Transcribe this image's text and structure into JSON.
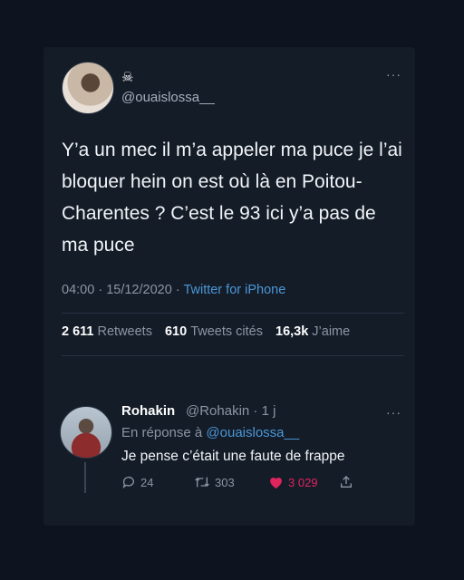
{
  "tweet": {
    "icon": "skull-icon",
    "handle": "@ouaislossa__",
    "text": "Y’a un mec il m’a appeler ma puce je l’ai bloquer hein on est où là en Poitou-Charentes ? C’est le 93 ici y’a pas de ma puce",
    "time": "04:00",
    "date": "15/12/2020",
    "separator": "·",
    "source": "Twitter for iPhone",
    "stats": {
      "retweets_count": "2 611",
      "retweets_label": "Retweets",
      "quotes_count": "610",
      "quotes_label": "Tweets cités",
      "likes_count": "16,3k",
      "likes_label": "J’aime"
    },
    "more": "···"
  },
  "reply": {
    "name": "Rohakin",
    "handle": "@Rohakin · 1 j",
    "in_reply_prefix": "En réponse à",
    "in_reply_mention": "@ouaislossa__",
    "text": "Je pense c’était une faute de frappe",
    "replies": "24",
    "retweets": "303",
    "likes": "3 029",
    "more": "···",
    "like_color": "#e0245e"
  },
  "colors": {
    "background": "#0d1420",
    "link": "#4b97d6"
  }
}
